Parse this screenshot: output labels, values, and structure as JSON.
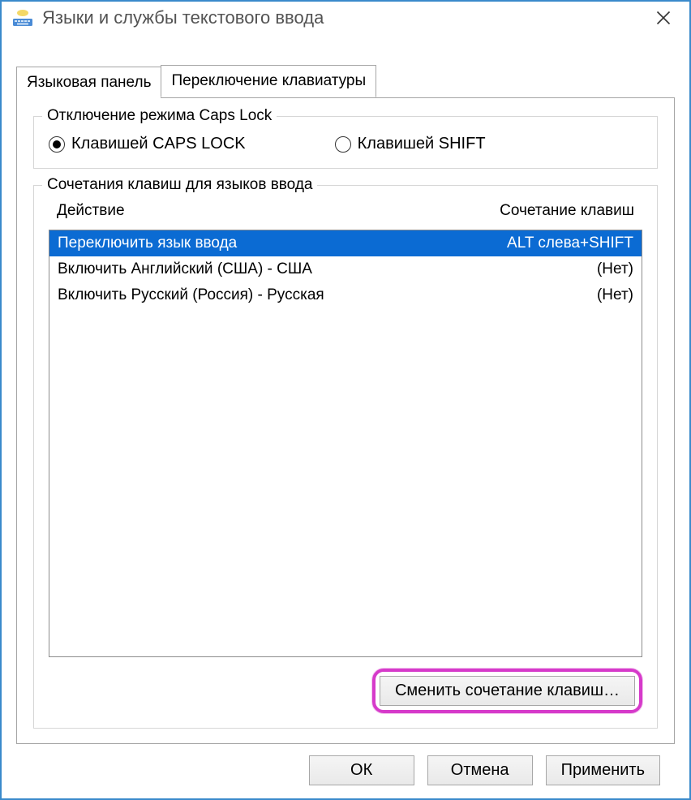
{
  "window": {
    "title": "Языки и службы текстового ввода"
  },
  "tabs": {
    "tab0": "Языковая панель",
    "tab1": "Переключение клавиатуры",
    "active": 1
  },
  "capsGroup": {
    "legend": "Отключение режима Caps Lock",
    "option0": "Клавишей CAPS LOCK",
    "option1": "Клавишей SHIFT",
    "selected": 0
  },
  "hotkeyGroup": {
    "legend": "Сочетания клавиш для языков ввода",
    "headers": {
      "action": "Действие",
      "key": "Сочетание клавиш"
    },
    "rows": [
      {
        "action": "Переключить язык ввода",
        "key": "ALT слева+SHIFT",
        "selected": true
      },
      {
        "action": "Включить Английский (США) - США",
        "key": "(Нет)",
        "selected": false
      },
      {
        "action": "Включить Русский (Россия) - Русская",
        "key": "(Нет)",
        "selected": false
      }
    ],
    "changeButton": "Сменить сочетание клавиш…"
  },
  "buttons": {
    "ok": "ОК",
    "cancel": "Отмена",
    "apply": "Применить"
  }
}
